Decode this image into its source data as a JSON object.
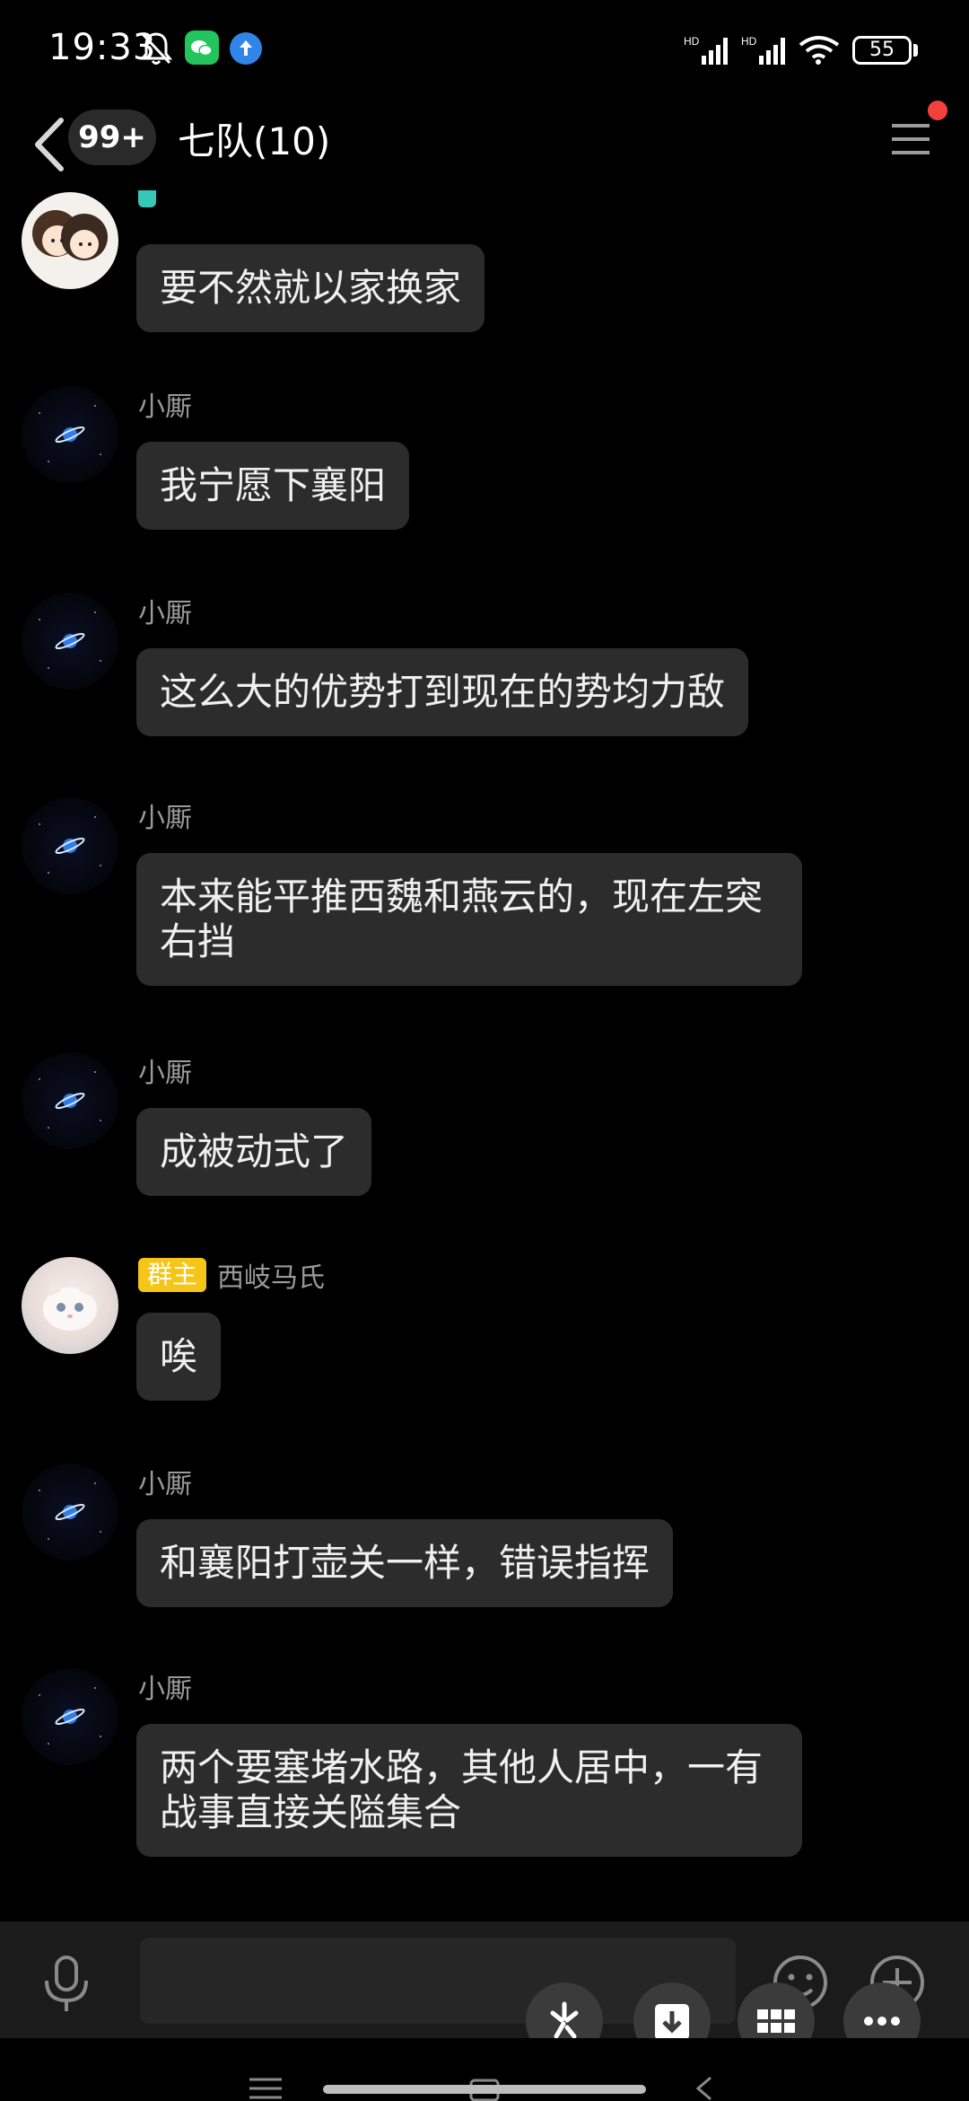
{
  "status_bar": {
    "time": "19:33",
    "battery": "55",
    "signal_labels": [
      "HD",
      "HD"
    ]
  },
  "header": {
    "unread_count": "99+",
    "title": "七队(10)"
  },
  "messages": [
    {
      "sender": "",
      "role_tag": "",
      "avatar": "girls-avatar",
      "text": "要不然就以家换家",
      "partially_hidden_header": true
    },
    {
      "sender": "小厮",
      "role_tag": "",
      "avatar": "planet-avatar",
      "text": "我宁愿下襄阳"
    },
    {
      "sender": "小厮",
      "role_tag": "",
      "avatar": "planet-avatar",
      "text": "这么大的优势打到现在的势均力敌"
    },
    {
      "sender": "小厮",
      "role_tag": "",
      "avatar": "planet-avatar",
      "text": "本来能平推西魏和燕云的，现在左突右挡"
    },
    {
      "sender": "小厮",
      "role_tag": "",
      "avatar": "planet-avatar",
      "text": "成被动式了"
    },
    {
      "sender": "西岐马氏",
      "role_tag": "群主",
      "avatar": "cat-avatar",
      "text": "唉"
    },
    {
      "sender": "小厮",
      "role_tag": "",
      "avatar": "planet-avatar",
      "text": "和襄阳打壶关一样，错误指挥"
    },
    {
      "sender": "小厮",
      "role_tag": "",
      "avatar": "planet-avatar",
      "text": "两个要塞堵水路，其他人居中，一有战事直接关隘集合"
    }
  ],
  "input": {
    "placeholder": ""
  },
  "colors": {
    "background": "#000000",
    "bubble": "#2c2c2c",
    "owner_tag": "#f5c518",
    "admin_tag": "#37c7b7",
    "notification_dot": "#f43f3f"
  }
}
